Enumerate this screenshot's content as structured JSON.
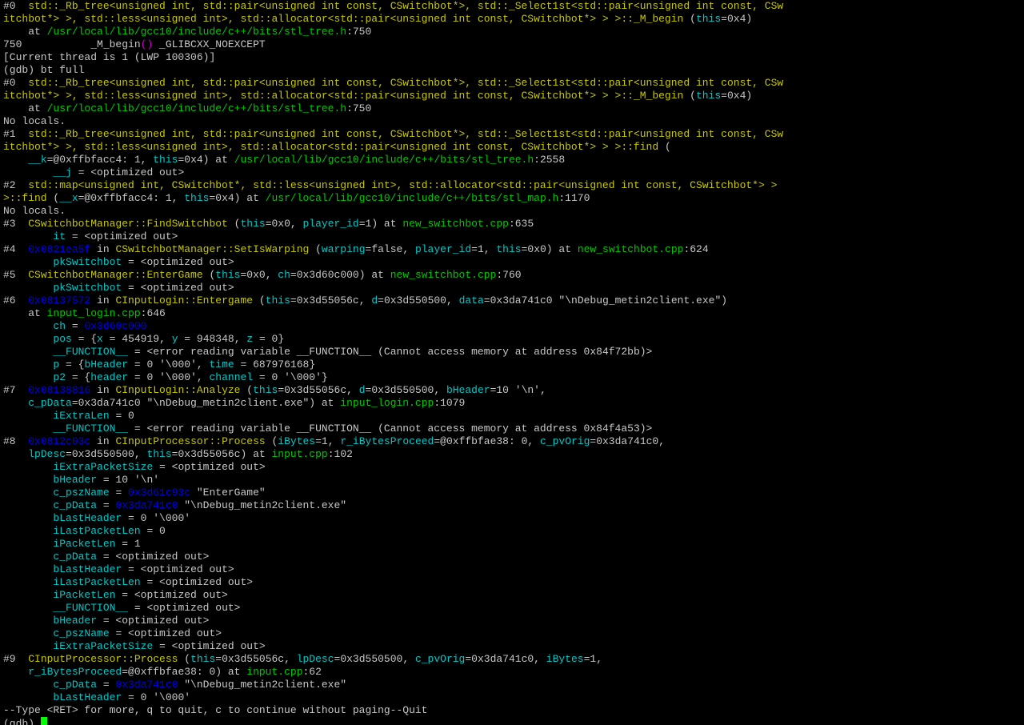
{
  "terminal": {
    "colors": {
      "background": "#000000",
      "default_text": "#c8c8c8",
      "function_name": "#c8c800",
      "file_path": "#00c800",
      "variable": "#00c8c8",
      "value_parens": "#c800c8",
      "address": "#0000e6",
      "cursor": "#00ff00"
    },
    "lines": [
      [
        [
          "w",
          "#0  "
        ],
        [
          "y",
          "std::_Rb_tree<unsigned int, std::pair<unsigned int const, CSwitchbot*>, std::_Select1st<std::pair<unsigned int const, CSw"
        ]
      ],
      [
        [
          "y",
          "itchbot*> >, std::less<unsigned int>, std::allocator<std::pair<unsigned int const, CSwitchbot*> > >::_M_begin"
        ],
        [
          "w",
          " ("
        ],
        [
          "c",
          "this"
        ],
        [
          "w",
          "=0x4)"
        ]
      ],
      [
        [
          "w",
          "    at "
        ],
        [
          "g",
          "/usr/local/lib/gcc10/include/c++/bits/stl_tree.h"
        ],
        [
          "w",
          ":750"
        ]
      ],
      [
        [
          "w",
          "750           _M_begin"
        ],
        [
          "m",
          "()"
        ],
        [
          "w",
          " _GLIBCXX_NOEXCEPT"
        ]
      ],
      [
        [
          "w",
          "[Current thread is 1 (LWP 100306)]"
        ]
      ],
      [
        [
          "w",
          "(gdb) bt full"
        ]
      ],
      [
        [
          "w",
          "#0  "
        ],
        [
          "y",
          "std::_Rb_tree<unsigned int, std::pair<unsigned int const, CSwitchbot*>, std::_Select1st<std::pair<unsigned int const, CSw"
        ]
      ],
      [
        [
          "y",
          "itchbot*> >, std::less<unsigned int>, std::allocator<std::pair<unsigned int const, CSwitchbot*> > >::_M_begin"
        ],
        [
          "w",
          " ("
        ],
        [
          "c",
          "this"
        ],
        [
          "w",
          "=0x4)"
        ]
      ],
      [
        [
          "w",
          "    at "
        ],
        [
          "g",
          "/usr/local/lib/gcc10/include/c++/bits/stl_tree.h"
        ],
        [
          "w",
          ":750"
        ]
      ],
      [
        [
          "w",
          "No locals."
        ]
      ],
      [
        [
          "w",
          "#1  "
        ],
        [
          "y",
          "std::_Rb_tree<unsigned int, std::pair<unsigned int const, CSwitchbot*>, std::_Select1st<std::pair<unsigned int const, CSw"
        ]
      ],
      [
        [
          "y",
          "itchbot*> >, std::less<unsigned int>, std::allocator<std::pair<unsigned int const, CSwitchbot*> > >::find"
        ],
        [
          "w",
          " ("
        ]
      ],
      [
        [
          "w",
          "    "
        ],
        [
          "c",
          "__k"
        ],
        [
          "w",
          "=@0xffbfacc4: 1, "
        ],
        [
          "c",
          "this"
        ],
        [
          "w",
          "=0x4) at "
        ],
        [
          "g",
          "/usr/local/lib/gcc10/include/c++/bits/stl_tree.h"
        ],
        [
          "w",
          ":2558"
        ]
      ],
      [
        [
          "w",
          "        "
        ],
        [
          "c",
          "__j"
        ],
        [
          "w",
          " = <optimized out>"
        ]
      ],
      [
        [
          "w",
          "#2  "
        ],
        [
          "y",
          "std::map<unsigned int, CSwitchbot*, std::less<unsigned int>, std::allocator<std::pair<unsigned int const, CSwitchbot*> >"
        ]
      ],
      [
        [
          "y",
          ">::find"
        ],
        [
          "w",
          " ("
        ],
        [
          "c",
          "__x"
        ],
        [
          "w",
          "=@0xffbfacc4: 1, "
        ],
        [
          "c",
          "this"
        ],
        [
          "w",
          "=0x4) at "
        ],
        [
          "g",
          "/usr/local/lib/gcc10/include/c++/bits/stl_map.h"
        ],
        [
          "w",
          ":1170"
        ]
      ],
      [
        [
          "w",
          "No locals."
        ]
      ],
      [
        [
          "w",
          "#3  "
        ],
        [
          "y",
          "CSwitchbotManager::FindSwitchbot"
        ],
        [
          "w",
          " ("
        ],
        [
          "c",
          "this"
        ],
        [
          "w",
          "=0x0, "
        ],
        [
          "c",
          "player_id"
        ],
        [
          "w",
          "=1) at "
        ],
        [
          "g",
          "new_switchbot.cpp"
        ],
        [
          "w",
          ":635"
        ]
      ],
      [
        [
          "w",
          "        "
        ],
        [
          "c",
          "it"
        ],
        [
          "w",
          " = <optimized out>"
        ]
      ],
      [
        [
          "w",
          "#4  "
        ],
        [
          "b",
          "0x0821ea5f"
        ],
        [
          "w",
          " in "
        ],
        [
          "y",
          "CSwitchbotManager::SetIsWarping"
        ],
        [
          "w",
          " ("
        ],
        [
          "c",
          "warping"
        ],
        [
          "w",
          "=false, "
        ],
        [
          "c",
          "player_id"
        ],
        [
          "w",
          "=1, "
        ],
        [
          "c",
          "this"
        ],
        [
          "w",
          "=0x0) at "
        ],
        [
          "g",
          "new_switchbot.cpp"
        ],
        [
          "w",
          ":624"
        ]
      ],
      [
        [
          "w",
          "        "
        ],
        [
          "c",
          "pkSwitchbot"
        ],
        [
          "w",
          " = <optimized out>"
        ]
      ],
      [
        [
          "w",
          "#5  "
        ],
        [
          "y",
          "CSwitchbotManager::EnterGame"
        ],
        [
          "w",
          " ("
        ],
        [
          "c",
          "this"
        ],
        [
          "w",
          "=0x0, "
        ],
        [
          "c",
          "ch"
        ],
        [
          "w",
          "=0x3d60c000) at "
        ],
        [
          "g",
          "new_switchbot.cpp"
        ],
        [
          "w",
          ":760"
        ]
      ],
      [
        [
          "w",
          "        "
        ],
        [
          "c",
          "pkSwitchbot"
        ],
        [
          "w",
          " = <optimized out>"
        ]
      ],
      [
        [
          "w",
          "#6  "
        ],
        [
          "b",
          "0x08137572"
        ],
        [
          "w",
          " in "
        ],
        [
          "y",
          "CInputLogin::Entergame"
        ],
        [
          "w",
          " ("
        ],
        [
          "c",
          "this"
        ],
        [
          "w",
          "=0x3d55056c, "
        ],
        [
          "c",
          "d"
        ],
        [
          "w",
          "=0x3d550500, "
        ],
        [
          "c",
          "data"
        ],
        [
          "w",
          "=0x3da741c0 \"\\nDebug_metin2client.exe\")"
        ]
      ],
      [
        [
          "w",
          "    at "
        ],
        [
          "g",
          "input_login.cpp"
        ],
        [
          "w",
          ":646"
        ]
      ],
      [
        [
          "w",
          "        "
        ],
        [
          "c",
          "ch"
        ],
        [
          "w",
          " = "
        ],
        [
          "b",
          "0x3d60c000"
        ]
      ],
      [
        [
          "w",
          "        "
        ],
        [
          "c",
          "pos"
        ],
        [
          "w",
          " = {"
        ],
        [
          "c",
          "x"
        ],
        [
          "w",
          " = 454919, "
        ],
        [
          "c",
          "y"
        ],
        [
          "w",
          " = 948348, "
        ],
        [
          "c",
          "z"
        ],
        [
          "w",
          " = 0}"
        ]
      ],
      [
        [
          "w",
          "        "
        ],
        [
          "c",
          "__FUNCTION__"
        ],
        [
          "w",
          " = <error reading variable __FUNCTION__ (Cannot access memory at address 0x84f72bb)>"
        ]
      ],
      [
        [
          "w",
          "        "
        ],
        [
          "c",
          "p"
        ],
        [
          "w",
          " = {"
        ],
        [
          "c",
          "bHeader"
        ],
        [
          "w",
          " = 0 '\\000', "
        ],
        [
          "c",
          "time"
        ],
        [
          "w",
          " = 687976168}"
        ]
      ],
      [
        [
          "w",
          "        "
        ],
        [
          "c",
          "p2"
        ],
        [
          "w",
          " = {"
        ],
        [
          "c",
          "header"
        ],
        [
          "w",
          " = 0 '\\000', "
        ],
        [
          "c",
          "channel"
        ],
        [
          "w",
          " = 0 '\\000'}"
        ]
      ],
      [
        [
          "w",
          "#7  "
        ],
        [
          "b",
          "0x08138816"
        ],
        [
          "w",
          " in "
        ],
        [
          "y",
          "CInputLogin::Analyze"
        ],
        [
          "w",
          " ("
        ],
        [
          "c",
          "this"
        ],
        [
          "w",
          "=0x3d55056c, "
        ],
        [
          "c",
          "d"
        ],
        [
          "w",
          "=0x3d550500, "
        ],
        [
          "c",
          "bHeader"
        ],
        [
          "w",
          "=10 '\\n',"
        ]
      ],
      [
        [
          "w",
          "    "
        ],
        [
          "c",
          "c_pData"
        ],
        [
          "w",
          "=0x3da741c0 \"\\nDebug_metin2client.exe\") at "
        ],
        [
          "g",
          "input_login.cpp"
        ],
        [
          "w",
          ":1079"
        ]
      ],
      [
        [
          "w",
          "        "
        ],
        [
          "c",
          "iExtraLen"
        ],
        [
          "w",
          " = 0"
        ]
      ],
      [
        [
          "w",
          "        "
        ],
        [
          "c",
          "__FUNCTION__"
        ],
        [
          "w",
          " = <error reading variable __FUNCTION__ (Cannot access memory at address 0x84f4a53)>"
        ]
      ],
      [
        [
          "w",
          "#8  "
        ],
        [
          "b",
          "0x0812c03c"
        ],
        [
          "w",
          " in "
        ],
        [
          "y",
          "CInputProcessor::Process"
        ],
        [
          "w",
          " ("
        ],
        [
          "c",
          "iBytes"
        ],
        [
          "w",
          "=1, "
        ],
        [
          "c",
          "r_iBytesProceed"
        ],
        [
          "w",
          "=@0xffbfae38: 0, "
        ],
        [
          "c",
          "c_pvOrig"
        ],
        [
          "w",
          "=0x3da741c0,"
        ]
      ],
      [
        [
          "w",
          "    "
        ],
        [
          "c",
          "lpDesc"
        ],
        [
          "w",
          "=0x3d550500, "
        ],
        [
          "c",
          "this"
        ],
        [
          "w",
          "=0x3d55056c) at "
        ],
        [
          "g",
          "input.cpp"
        ],
        [
          "w",
          ":102"
        ]
      ],
      [
        [
          "w",
          "        "
        ],
        [
          "c",
          "iExtraPacketSize"
        ],
        [
          "w",
          " = <optimized out>"
        ]
      ],
      [
        [
          "w",
          "        "
        ],
        [
          "c",
          "bHeader"
        ],
        [
          "w",
          " = 10 '\\n'"
        ]
      ],
      [
        [
          "w",
          "        "
        ],
        [
          "c",
          "c_pszName"
        ],
        [
          "w",
          " = "
        ],
        [
          "b",
          "0x3d61c93c"
        ],
        [
          "w",
          " \"EnterGame\""
        ]
      ],
      [
        [
          "w",
          "        "
        ],
        [
          "c",
          "c_pData"
        ],
        [
          "w",
          " = "
        ],
        [
          "b",
          "0x3da741c0"
        ],
        [
          "w",
          " \"\\nDebug_metin2client.exe\""
        ]
      ],
      [
        [
          "w",
          "        "
        ],
        [
          "c",
          "bLastHeader"
        ],
        [
          "w",
          " = 0 '\\000'"
        ]
      ],
      [
        [
          "w",
          "        "
        ],
        [
          "c",
          "iLastPacketLen"
        ],
        [
          "w",
          " = 0"
        ]
      ],
      [
        [
          "w",
          "        "
        ],
        [
          "c",
          "iPacketLen"
        ],
        [
          "w",
          " = 1"
        ]
      ],
      [
        [
          "w",
          "        "
        ],
        [
          "c",
          "c_pData"
        ],
        [
          "w",
          " = <optimized out>"
        ]
      ],
      [
        [
          "w",
          "        "
        ],
        [
          "c",
          "bLastHeader"
        ],
        [
          "w",
          " = <optimized out>"
        ]
      ],
      [
        [
          "w",
          "        "
        ],
        [
          "c",
          "iLastPacketLen"
        ],
        [
          "w",
          " = <optimized out>"
        ]
      ],
      [
        [
          "w",
          "        "
        ],
        [
          "c",
          "iPacketLen"
        ],
        [
          "w",
          " = <optimized out>"
        ]
      ],
      [
        [
          "w",
          "        "
        ],
        [
          "c",
          "__FUNCTION__"
        ],
        [
          "w",
          " = <optimized out>"
        ]
      ],
      [
        [
          "w",
          "        "
        ],
        [
          "c",
          "bHeader"
        ],
        [
          "w",
          " = <optimized out>"
        ]
      ],
      [
        [
          "w",
          "        "
        ],
        [
          "c",
          "c_pszName"
        ],
        [
          "w",
          " = <optimized out>"
        ]
      ],
      [
        [
          "w",
          "        "
        ],
        [
          "c",
          "iExtraPacketSize"
        ],
        [
          "w",
          " = <optimized out>"
        ]
      ],
      [
        [
          "w",
          "#9  "
        ],
        [
          "y",
          "CInputProcessor::Process"
        ],
        [
          "w",
          " ("
        ],
        [
          "c",
          "this"
        ],
        [
          "w",
          "=0x3d55056c, "
        ],
        [
          "c",
          "lpDesc"
        ],
        [
          "w",
          "=0x3d550500, "
        ],
        [
          "c",
          "c_pvOrig"
        ],
        [
          "w",
          "=0x3da741c0, "
        ],
        [
          "c",
          "iBytes"
        ],
        [
          "w",
          "=1,"
        ]
      ],
      [
        [
          "w",
          "    "
        ],
        [
          "c",
          "r_iBytesProceed"
        ],
        [
          "w",
          "=@0xffbfae38: 0) at "
        ],
        [
          "g",
          "input.cpp"
        ],
        [
          "w",
          ":62"
        ]
      ],
      [
        [
          "w",
          "        "
        ],
        [
          "c",
          "c_pData"
        ],
        [
          "w",
          " = "
        ],
        [
          "b",
          "0x3da741c0"
        ],
        [
          "w",
          " \"\\nDebug_metin2client.exe\""
        ]
      ],
      [
        [
          "w",
          "        "
        ],
        [
          "c",
          "bLastHeader"
        ],
        [
          "w",
          " = 0 '\\000'"
        ]
      ],
      [
        [
          "w",
          "--Type <RET> for more, q to quit, c to continue without paging--Quit"
        ]
      ]
    ],
    "prompt": {
      "text": "(gdb) "
    }
  }
}
